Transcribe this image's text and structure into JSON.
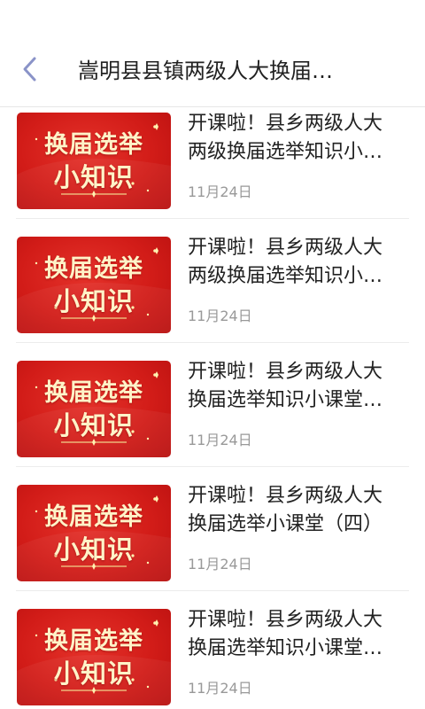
{
  "header": {
    "title": "嵩明县县镇两级人大换届…"
  },
  "thumb": {
    "line1": "换届选举",
    "line2": "小知识"
  },
  "articles": [
    {
      "title_line1": "开课啦！县乡两级人大",
      "title_line2": "两级换届选举知识小…",
      "date": "11月24日"
    },
    {
      "title_line1": "开课啦！县乡两级人大",
      "title_line2": "两级换届选举知识小…",
      "date": "11月24日"
    },
    {
      "title_line1": "开课啦！县乡两级人大",
      "title_line2": "换届选举知识小课堂…",
      "date": "11月24日"
    },
    {
      "title_line1": "开课啦！县乡两级人大",
      "title_line2": "换届选举小课堂（四）",
      "date": "11月24日"
    },
    {
      "title_line1": "开课啦！县乡两级人大",
      "title_line2": "换届选举知识小课堂…",
      "date": "11月24日"
    }
  ],
  "colors": {
    "accent_back_arrow": "#8a93c8",
    "thumb_red": "#d21c18",
    "thumb_text": "#fff3c8",
    "date_gray": "#999999"
  },
  "icons": {
    "back": "chevron-left-icon",
    "sparkle": "sparkle-icon"
  }
}
